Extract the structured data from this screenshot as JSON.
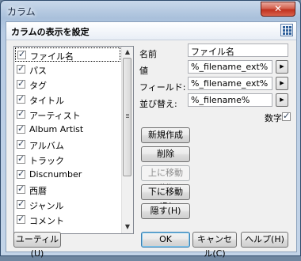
{
  "window": {
    "title": "カラム",
    "close_glyph": "✕"
  },
  "header": {
    "title": "カラムの表示を設定",
    "icon": "grid-icon"
  },
  "columns": [
    {
      "label": "ファイル名",
      "checked": true,
      "selected": true
    },
    {
      "label": "パス",
      "checked": true
    },
    {
      "label": "タグ",
      "checked": true
    },
    {
      "label": "タイトル",
      "checked": true
    },
    {
      "label": "アーティスト",
      "checked": true
    },
    {
      "label": "Album Artist",
      "checked": true
    },
    {
      "label": "アルバム",
      "checked": true
    },
    {
      "label": "トラック",
      "checked": true
    },
    {
      "label": "Discnumber",
      "checked": true
    },
    {
      "label": "西暦",
      "checked": true
    },
    {
      "label": "ジャンル",
      "checked": true
    },
    {
      "label": "コメント",
      "checked": true
    }
  ],
  "form": {
    "name_label": "名前",
    "name_value": "ファイル名",
    "value_label": "値",
    "value_value": "%_filename_ext%",
    "field_label": "フィールド:",
    "field_value": "%_filename_ext%",
    "sort_label": "並び替え:",
    "sort_value": "%_filename%",
    "numeric_label": "数字"
  },
  "buttons": {
    "new": "新規作成",
    "delete": "削除",
    "move_up": "上に移動(U)",
    "move_down": "下に移動(D)",
    "hide": "隠す(H)",
    "utility": "ユーティル(U)",
    "ok": "OK",
    "cancel": "キャンセル(C)",
    "help": "ヘルプ(H)"
  }
}
